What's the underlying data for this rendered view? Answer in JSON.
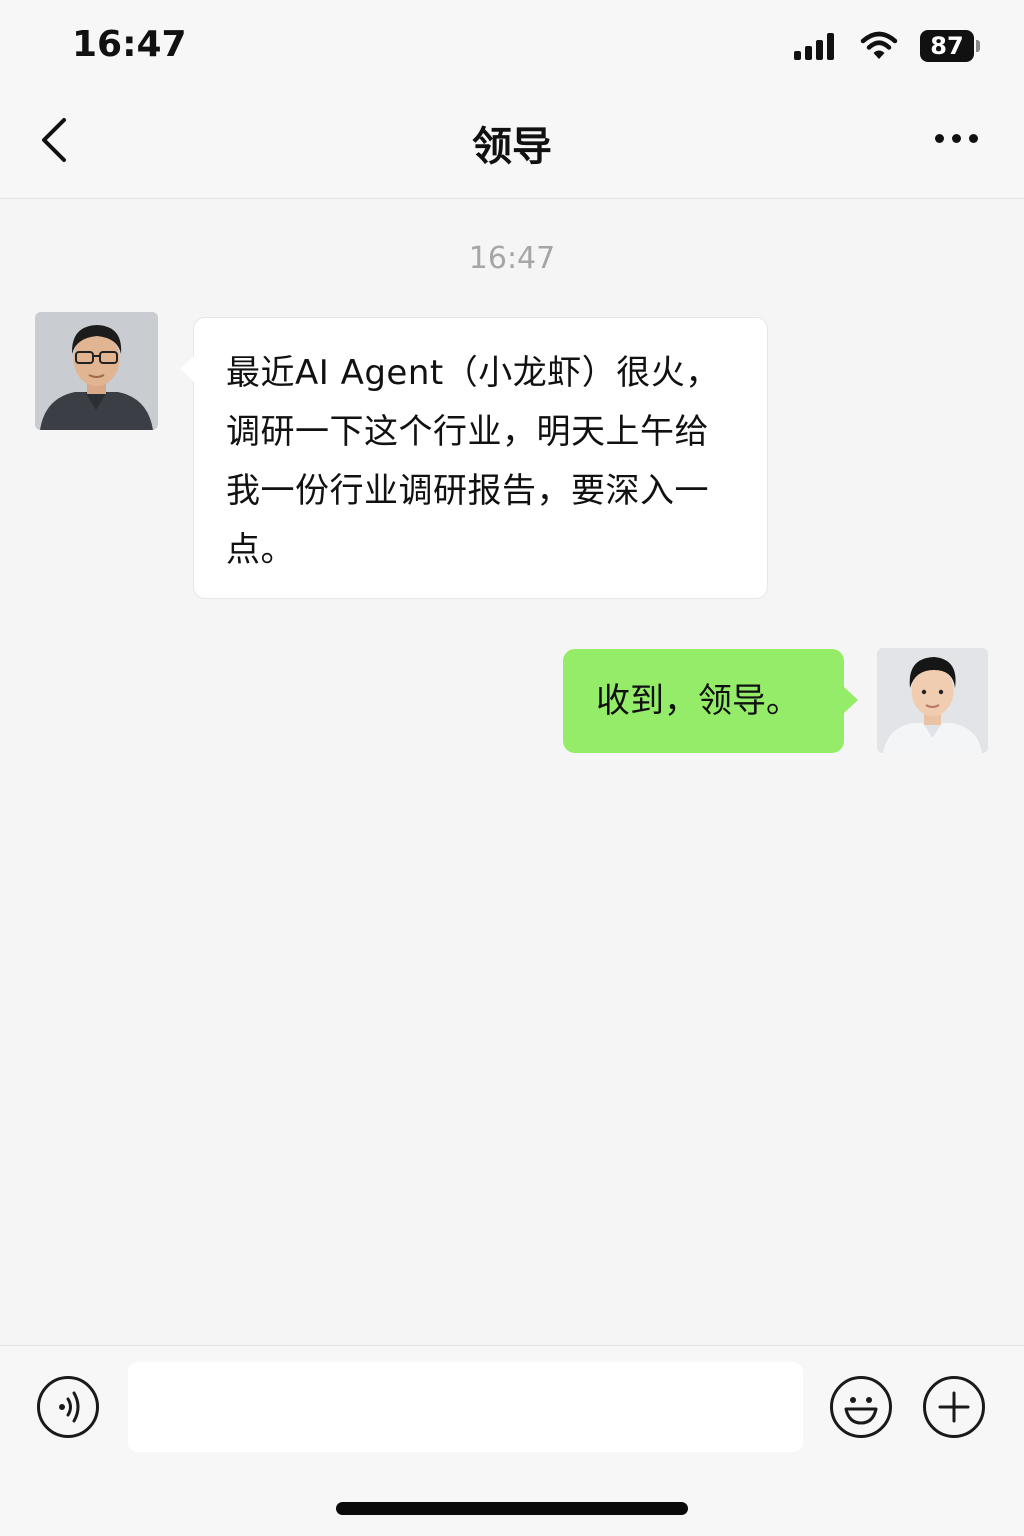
{
  "status_bar": {
    "time": "16:47",
    "battery": "87",
    "icons": [
      "signal-icon",
      "wifi-icon",
      "battery-icon"
    ]
  },
  "nav": {
    "title": "领导",
    "back_icon": "chevron-left-icon",
    "more_icon": "more-dots-icon"
  },
  "chat": {
    "timestamp": "16:47",
    "messages": [
      {
        "sender": "leader",
        "direction": "incoming",
        "text": "最近AI Agent（小龙虾）很火，调研一下这个行业，明天上午给我一份行业调研报告，要深入一点。"
      },
      {
        "sender": "me",
        "direction": "outgoing",
        "text": "收到，领导。"
      }
    ]
  },
  "input_bar": {
    "value": "",
    "icons": [
      "voice-icon",
      "emoji-icon",
      "plus-icon"
    ]
  },
  "colors": {
    "outgoing_bubble": "#95ec69",
    "incoming_bubble": "#ffffff",
    "background": "#f5f5f5",
    "timestamp": "#a6a6a6"
  }
}
